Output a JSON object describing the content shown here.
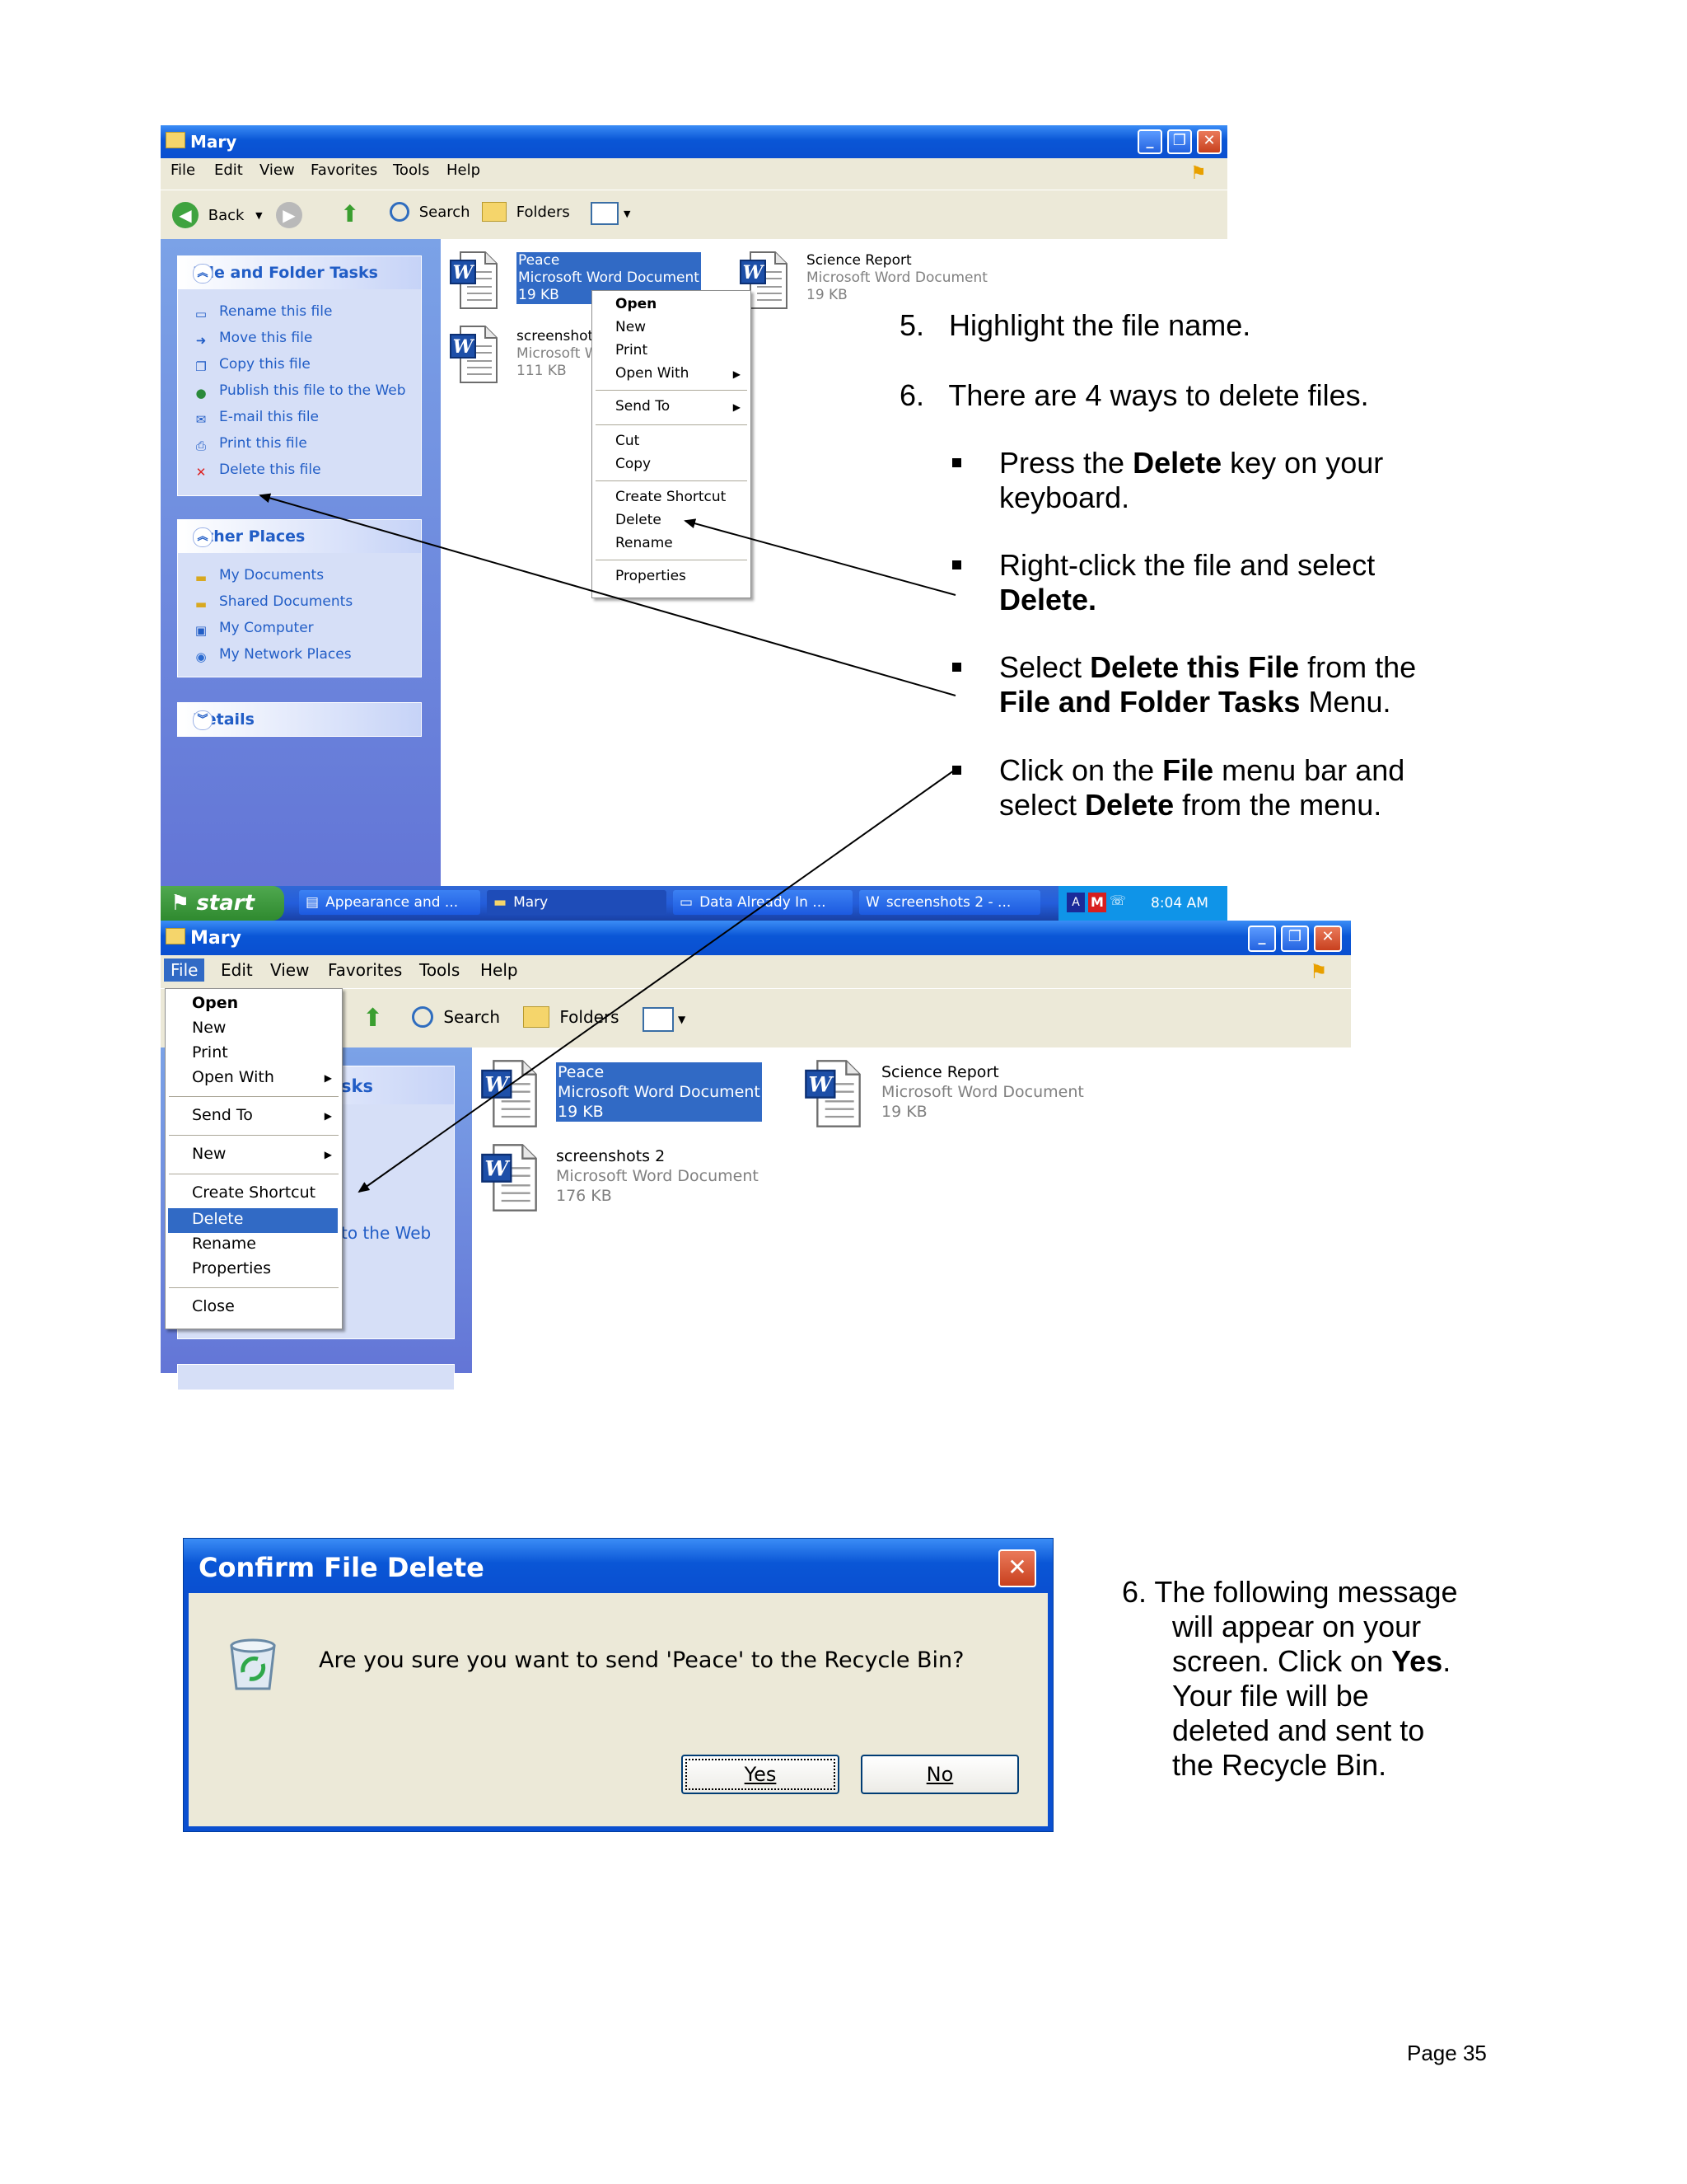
{
  "window1": {
    "title": "Mary",
    "menu": [
      "File",
      "Edit",
      "View",
      "Favorites",
      "Tools",
      "Help"
    ],
    "toolbar": {
      "back": "Back",
      "search": "Search",
      "folders": "Folders"
    },
    "file_tasks_title": "File and Folder Tasks",
    "file_tasks": [
      "Rename this file",
      "Move this file",
      "Copy this file",
      "Publish this file to the Web",
      "E-mail this file",
      "Print this file",
      "Delete this file"
    ],
    "other_places_title": "Other Places",
    "other_places": [
      "My Documents",
      "Shared Documents",
      "My Computer",
      "My Network Places"
    ],
    "details_title": "Details",
    "files": [
      {
        "name": "Peace",
        "type": "Microsoft Word Document",
        "size": "19 KB"
      },
      {
        "name": "Science Report",
        "type": "Microsoft Word Document",
        "size": "19 KB"
      },
      {
        "name": "screenshots",
        "type": "Microsoft W",
        "size": "111 KB"
      }
    ],
    "context_menu": [
      "Open",
      "New",
      "Print",
      "Open With",
      "Send To",
      "Cut",
      "Copy",
      "Create Shortcut",
      "Delete",
      "Rename",
      "Properties"
    ]
  },
  "taskbar": {
    "start": "start",
    "buttons": [
      "Appearance and ...",
      "Mary",
      "Data Already In ...",
      "screenshots 2 - ..."
    ],
    "time": "8:04 AM"
  },
  "window2": {
    "title": "Mary",
    "menu": [
      "File",
      "Edit",
      "View",
      "Favorites",
      "Tools",
      "Help"
    ],
    "toolbar": {
      "search": "Search",
      "folders": "Folders"
    },
    "partial_tasks": "sks",
    "partial_web": "to the Web",
    "files": [
      {
        "name": "Peace",
        "type": "Microsoft Word Document",
        "size": "19 KB"
      },
      {
        "name": "Science Report",
        "type": "Microsoft Word Document",
        "size": "19 KB"
      },
      {
        "name": "screenshots 2",
        "type": "Microsoft Word Document",
        "size": "176 KB"
      }
    ],
    "file_menu": [
      "Open",
      "New",
      "Print",
      "Open With",
      "Send To",
      "New",
      "Create Shortcut",
      "Delete",
      "Rename",
      "Properties",
      "Close"
    ]
  },
  "instructions": {
    "step5": "5.   Highlight the file name.",
    "step6": "6.   There are 4 ways to delete files.",
    "b1_pre": "Press the ",
    "b1_bold": "Delete",
    "b1_post": " key on your",
    "b1_line2": "keyboard.",
    "b2_line1": "Right-click the file and select",
    "b2_bold": "Delete.",
    "b3_pre": "Select ",
    "b3_bold": "Delete this File",
    "b3_post": " from the",
    "b3_bold2": "File and Folder Tasks",
    "b3_post2": " Menu.",
    "b4_pre": "Click on the ",
    "b4_bold": "File",
    "b4_post": " menu bar and",
    "b4_pre2": "select ",
    "b4_bold2": "Delete",
    "b4_post2": " from the menu."
  },
  "dialog": {
    "title": "Confirm File Delete",
    "message": "Are you sure you want to send 'Peace' to the Recycle Bin?",
    "yes": "Yes",
    "no": "No"
  },
  "step6b": {
    "l1": "6.  The following message",
    "l2": "will appear on your",
    "l3_pre": "screen.  Click on ",
    "l3_bold": "Yes",
    "l3_post": ".",
    "l4": "Your file will be",
    "l5": "deleted and sent to",
    "l6": "the Recycle Bin."
  },
  "footer": {
    "page": "Page 35"
  }
}
